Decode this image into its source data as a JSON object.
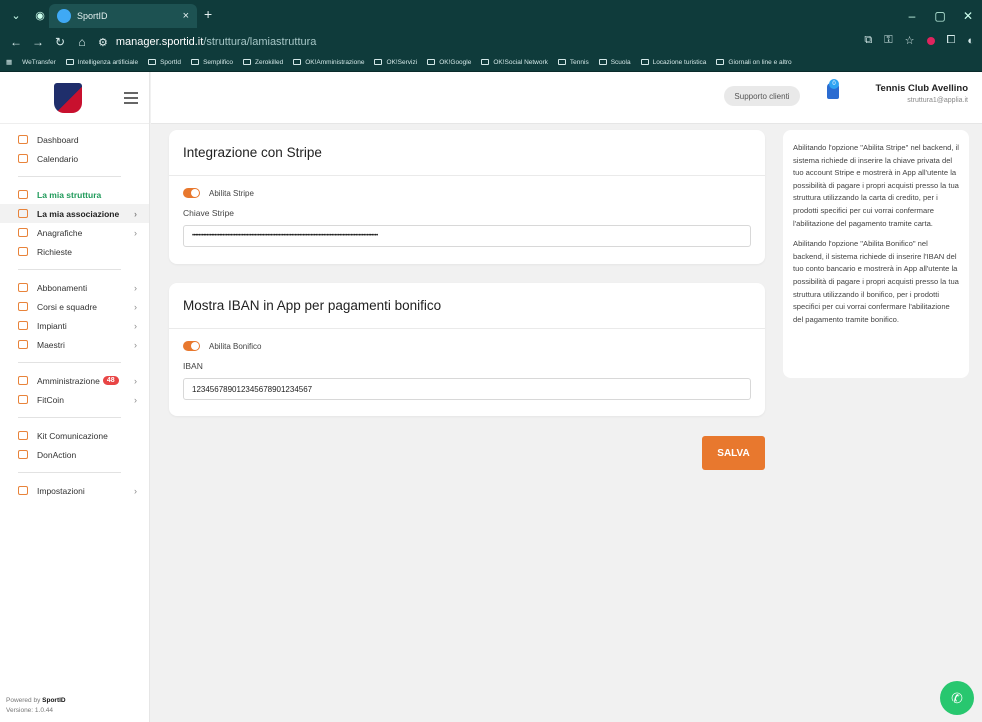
{
  "browser": {
    "tab_title": "SportID",
    "tab_close": "×",
    "new_tab": "+",
    "url_host": "manager.sportid.it",
    "url_path": "/struttura/lamiastruttura",
    "bookmarks": [
      "WeTransfer",
      "Intelligenza artificiale",
      "SportId",
      "Semplifico",
      "Zerokilled",
      "OK!Amministrazione",
      "OK!Servizi",
      "OK!Google",
      "OK!Social Network",
      "Tennis",
      "Scuola",
      "Locazione turistica",
      "Giornali on line e altro"
    ]
  },
  "sidebar": {
    "items": [
      {
        "label": "Dashboard"
      },
      {
        "label": "Calendario"
      },
      {
        "label": "La mia struttura"
      },
      {
        "label": "La mia associazione"
      },
      {
        "label": "Anagrafiche"
      },
      {
        "label": "Richieste"
      },
      {
        "label": "Abbonamenti"
      },
      {
        "label": "Corsi e squadre"
      },
      {
        "label": "Impianti"
      },
      {
        "label": "Maestri"
      },
      {
        "label": "Amministrazione",
        "badge": "48"
      },
      {
        "label": "FitCoin"
      },
      {
        "label": "Kit Comunicazione"
      },
      {
        "label": "DonAction"
      },
      {
        "label": "Impostazioni"
      }
    ],
    "powered_prefix": "Powered by ",
    "powered_brand": "SportID",
    "version": "Versione: 1.0.44"
  },
  "topbar": {
    "support_label": "Supporto clienti",
    "notifications_count": "0",
    "club_name": "Tennis Club Avellino",
    "club_email": "struttura1@applia.it"
  },
  "stripe": {
    "title": "Integrazione con Stripe",
    "toggle_label": "Abilita Stripe",
    "field_label": "Chiave Stripe",
    "field_value": "••••••••••••••••••••••••••••••••••••••••••••••••••••••••••••••••••••••••••••••••••••••••••••••••••••••••••••••••••••"
  },
  "iban": {
    "title": "Mostra IBAN in App per pagamenti bonifico",
    "toggle_label": "Abilita Bonifico",
    "field_label": "IBAN",
    "field_value": "123456789012345678901234567"
  },
  "info": {
    "p1": "Abilitando l'opzione \"Abilita Stripe\" nel backend, il sistema richiede di inserire la chiave privata del tuo account Stripe e mostrerà in App all'utente la possibilità di pagare i propri acquisti presso la tua struttura utilizzando la carta di credito, per i prodotti specifici per cui vorrai confermare l'abilitazione del pagamento tramite carta.",
    "p2": "Abilitando l'opzione \"Abilita Bonifico\" nel backend, il sistema richiede di inserire l'IBAN del tuo conto bancario e mostrerà in App all'utente la possibilità di pagare i propri acquisti presso la tua struttura utilizzando il bonifico, per i prodotti specifici per cui vorrai confermare l'abilitazione del pagamento tramite bonifico."
  },
  "save_label": "SALVA",
  "colors": {
    "accent": "#e8782e",
    "active_menu": "#1f9a5a",
    "chrome": "#0f3b3b",
    "whatsapp": "#28c76f"
  }
}
